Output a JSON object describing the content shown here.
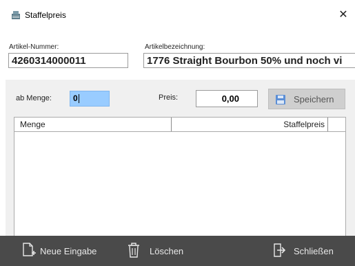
{
  "window": {
    "title": "Staffelpreis",
    "close_glyph": "✕"
  },
  "header": {
    "artikel_nummer_label": "Artikel-Nummer:",
    "artikel_nummer_value": "4260314000011",
    "artikelbezeichnung_label": "Artikelbezeichnung:",
    "artikelbezeichnung_value": "1776 Straight Bourbon 50% und noch vi"
  },
  "entry": {
    "menge_label": "ab Menge:",
    "menge_value": "0",
    "preis_label": "Preis:",
    "preis_value": "0,00",
    "save_label": "Speichern"
  },
  "table": {
    "columns": [
      "Menge",
      "Staffelpreis"
    ],
    "rows": []
  },
  "footer": {
    "new_label": "Neue Eingabe",
    "delete_label": "Löschen",
    "close_label": "Schließen"
  },
  "colors": {
    "footer_bg": "#4a4a4a",
    "qty_highlight": "#99ccff",
    "panel_bg": "#f0f0f0",
    "save_icon": "#5b8ed6"
  },
  "icons": [
    "app-icon",
    "close-icon",
    "save-icon",
    "new-entry-icon",
    "trash-icon",
    "exit-icon"
  ]
}
